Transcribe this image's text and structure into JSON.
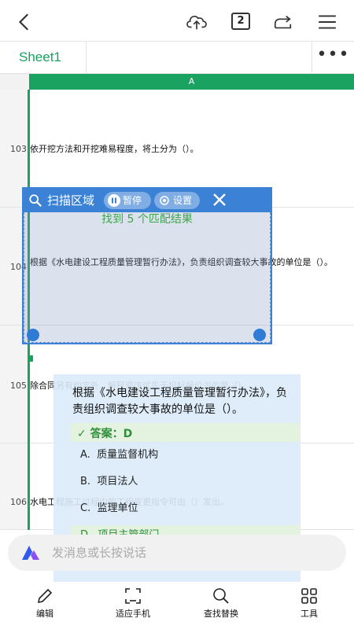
{
  "toolbar": {
    "back_icon": "chevron-left-icon",
    "upload_icon": "cloud-upload-icon",
    "page_count": "2",
    "share_icon": "share-icon",
    "menu_icon": "hamburger-menu-icon"
  },
  "tabs": {
    "sheet_name": "Sheet1",
    "more_label": "•••"
  },
  "grid": {
    "column_header": "A",
    "rows": [
      {
        "num": "103",
        "text": "依开挖方法和开挖难易程度，将土分为（）。"
      },
      {
        "num": "104",
        "text": "根据《水电建设工程质量管理暂行办法》，负责组织调查较大事故的单位是（）。"
      },
      {
        "num": "105",
        "text": "除合同另有约定外，解释顺序优先于投标报价书的是（）。"
      },
      {
        "num": "106",
        "text": "水电工程施工过程中的工程变更指令可由（）发出。"
      }
    ]
  },
  "scan": {
    "title": "扫描区域",
    "pause_label": "暂停",
    "settings_label": "设置",
    "found_text": "找到 5 个匹配结果",
    "accent_color": "#3b82d6"
  },
  "answer_card": {
    "question": "根据《水电建设工程质量管理暂行办法》，负责组织调查较大事故的单位是（）。",
    "answer_label": "✓ 答案：D",
    "options": [
      {
        "key": "A.",
        "text": "质量监督机构"
      },
      {
        "key": "B.",
        "text": "项目法人"
      },
      {
        "key": "C.",
        "text": "监理单位"
      },
      {
        "key": "D.",
        "text": "项目主管部门"
      }
    ],
    "correct_color": "#2f8f3a"
  },
  "message": {
    "placeholder": "发消息或长按说话"
  },
  "bottom_nav": [
    {
      "label": "编辑",
      "icon": "pencil-icon"
    },
    {
      "label": "适应手机",
      "icon": "fit-screen-icon"
    },
    {
      "label": "查找替换",
      "icon": "search-icon"
    },
    {
      "label": "工具",
      "icon": "grid-tools-icon"
    }
  ],
  "brand_color": "#1aa260"
}
